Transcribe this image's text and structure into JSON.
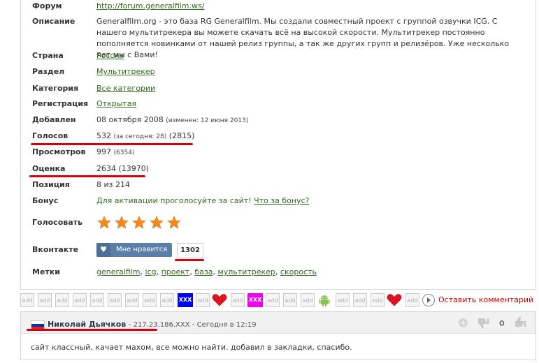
{
  "info": {
    "forum": {
      "label": "Форум",
      "value": "http://forum.generalfilm.ws/"
    },
    "description": {
      "label": "Описание",
      "text": "Generalfilm.org - это база RG Generalfilm. Мы создали совместный проект с группой озвучки ICG. С нашего мультитрекера вы можете скачать всё на высокой скорости. Мультитрекер постоянно пополняется новинками от нашей релиз группы, а так же других групп и релизёров. Уже несколько лет мы с Вами!"
    },
    "country": {
      "label": "Страна",
      "value": "Россия"
    },
    "section": {
      "label": "Раздел",
      "value": "Мультитрекер"
    },
    "category": {
      "label": "Категория",
      "value": "Все категории"
    },
    "registration": {
      "label": "Регистрация",
      "value": "Открытая"
    },
    "added": {
      "label": "Добавлен",
      "value": "08 октября 2008",
      "changed": "(изменен: 12 июня 2013)"
    },
    "votes": {
      "label": "Голосов",
      "value": "532",
      "today": "(за сегодня: 28)",
      "total": "(2815)"
    },
    "views": {
      "label": "Просмотров",
      "value": "997",
      "extra": "(6354)"
    },
    "rating": {
      "label": "Оценка",
      "value": "2634",
      "extra": "(13970)"
    },
    "position": {
      "label": "Позиция",
      "value": "8 из 214"
    },
    "bonus": {
      "label": "Бонус",
      "text": "Для активации проголосуйте за сайт!",
      "link": "Что за бонус?"
    },
    "vote": {
      "label": "Голосовать",
      "stars": 5
    },
    "vk": {
      "label": "Вконтакте",
      "button": "Мне нравится",
      "count": "1302",
      "heart": "♥"
    },
    "tags": {
      "label": "Метки",
      "items": [
        "generalfilm",
        "icg",
        "проект",
        "база",
        "мультитрекер",
        "скорость"
      ]
    }
  },
  "smileys": {
    "add_label": "add",
    "xxx_label": "XXX",
    "leave_comment": "Оставить комментарий"
  },
  "comment": {
    "author": "Николай Дьячков",
    "ip": "217.23.186.XXX",
    "time": "Сегодня в 12:19",
    "score": "0",
    "text": "сайт классный, качает махом, все можно найти. добавил в закладки, спасибо."
  },
  "colors": {
    "link": "#2f6b1b",
    "forum_link": "#cc0000",
    "highlight": "#d9000d",
    "vk": "#5b7fa6"
  }
}
